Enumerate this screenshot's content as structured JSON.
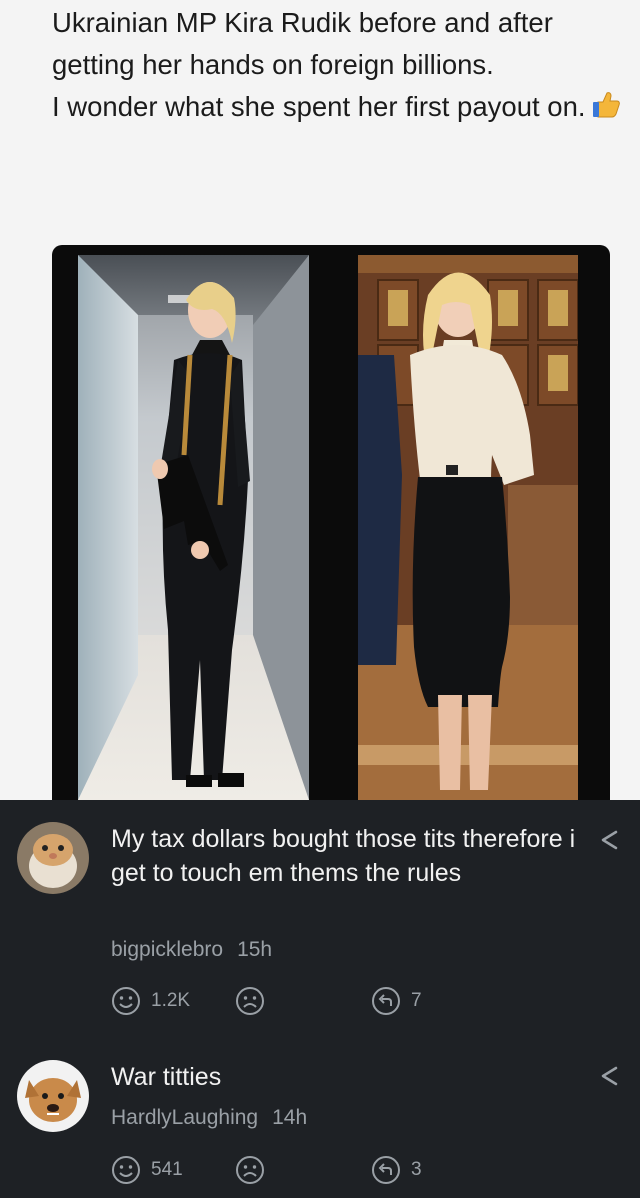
{
  "post": {
    "text_line1": "Ukrainian MP Kira Rudik before and after getting her hands on foreign billions.",
    "text_line2": "I wonder what she spent her first payout on.",
    "emoji_icon": "thumbs-up-icon"
  },
  "comments": [
    {
      "text": "My tax dollars bought those tits therefore i get to touch em thems the rules",
      "username": "bigpicklebro",
      "age": "15h",
      "likes": "1.2K",
      "replies": "7"
    },
    {
      "text": "War titties",
      "username": "HardlyLaughing",
      "age": "14h",
      "likes": "541",
      "replies": "3"
    }
  ],
  "colors": {
    "post_bg": "#f4f4f4",
    "comments_bg": "#1e2125",
    "comment_text": "#f1f1f1",
    "meta_text": "#9aa0a6"
  }
}
